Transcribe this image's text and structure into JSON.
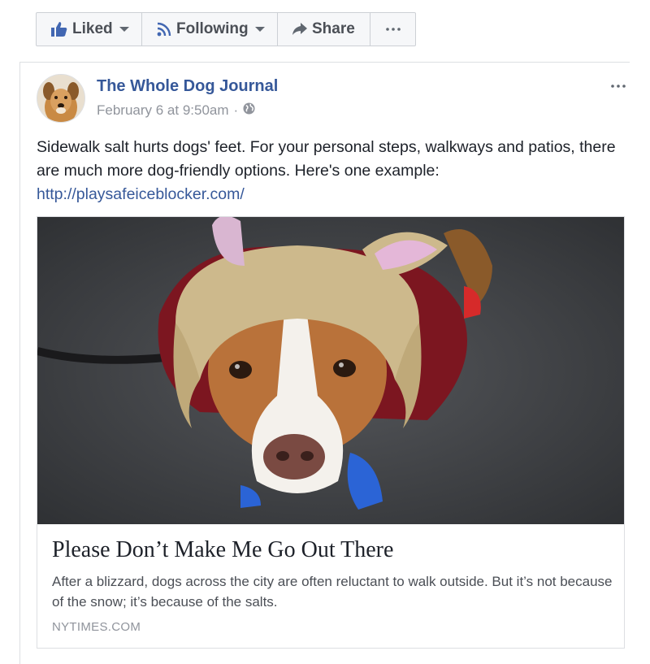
{
  "action_bar": {
    "liked_label": "Liked",
    "following_label": "Following",
    "share_label": "Share",
    "more_icon": "ellipsis-icon"
  },
  "post": {
    "page_name": "The Whole Dog Journal",
    "timestamp": "February 6 at 9:50am",
    "separator": "·",
    "privacy_icon": "globe-icon",
    "text": "Sidewalk salt hurts dogs' feet. For your personal steps, walkways and patios, there are much more dog-friendly options. Here's one example:",
    "link": "http://playsafeiceblocker.com/"
  },
  "link_preview": {
    "title": "Please Don’t Make Me Go Out There",
    "description": "After a blizzard, dogs across the city are often reluctant to walk outside. But it’s not because of the snow; it’s because of the salts.",
    "domain": "NYTIMES.COM"
  },
  "colors": {
    "link_blue": "#365899",
    "meta_gray": "#90949c",
    "border": "#dddfe2"
  }
}
